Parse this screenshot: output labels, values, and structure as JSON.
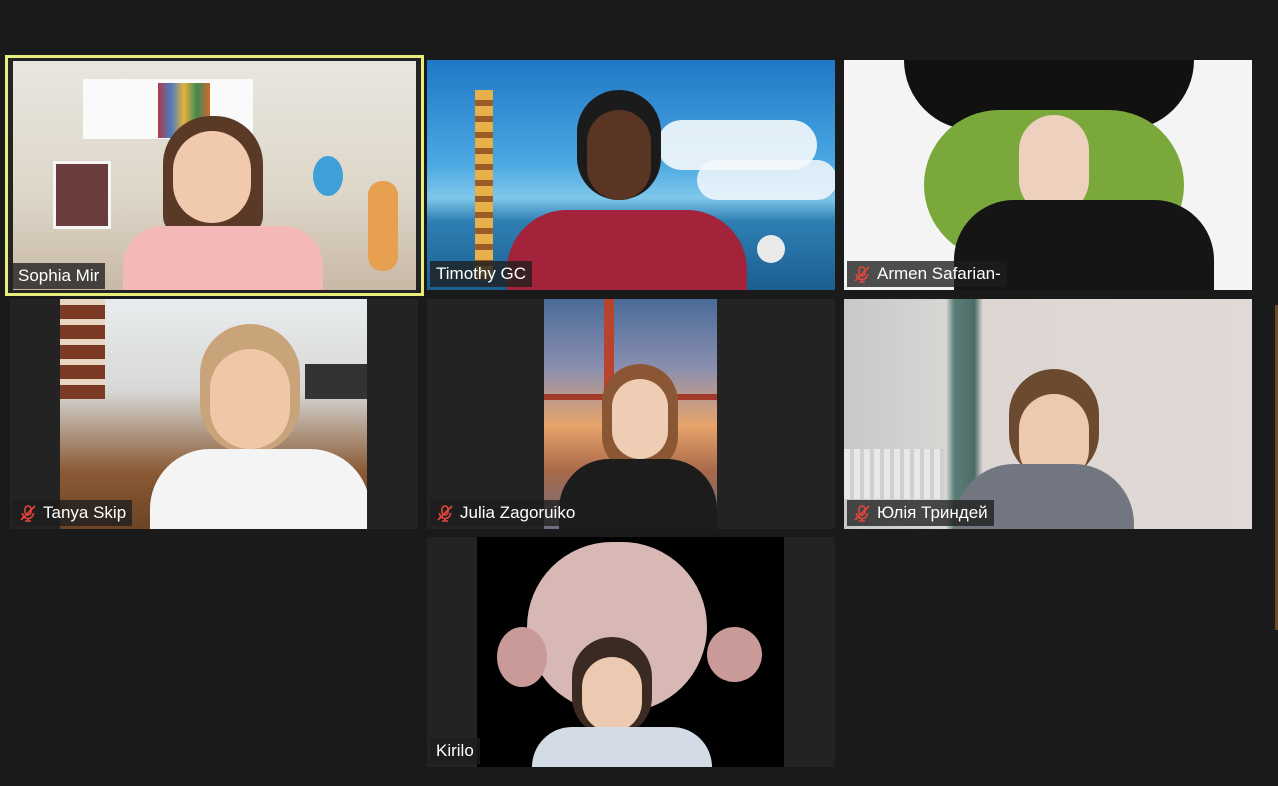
{
  "participants": [
    {
      "name": "Sophia Mir",
      "muted": false,
      "active_speaker": true,
      "bg": "#d9d3c8"
    },
    {
      "name": "Timothy GC",
      "muted": false,
      "active_speaker": false,
      "bg": "#3b8ec8"
    },
    {
      "name": "Armen Safarian-",
      "muted": true,
      "active_speaker": false,
      "bg": "#f0f0f0"
    },
    {
      "name": "Tanya Skip",
      "muted": true,
      "active_speaker": false,
      "bg": "#9a7a5c"
    },
    {
      "name": "Julia Zagoruiko",
      "muted": true,
      "active_speaker": false,
      "bg": "#c98a56"
    },
    {
      "name": "Юлія Триндей",
      "muted": true,
      "active_speaker": false,
      "bg": "#d8d2ce"
    },
    {
      "name": "Kirilo",
      "muted": false,
      "active_speaker": false,
      "bg": "#000000"
    }
  ],
  "colors": {
    "active_border": "#e8ec7a",
    "muted_red": "#e0463d",
    "tile_bg": "#232323",
    "page_bg": "#1a1a1a"
  },
  "icons": {
    "muted": "microphone-muted-icon"
  }
}
